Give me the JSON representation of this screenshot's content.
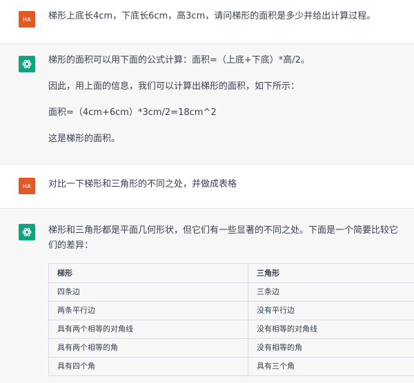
{
  "conversation": [
    {
      "role": "user",
      "avatar_label": "HA",
      "text": "梯形上底长4cm，下底长6cm，高3cm，请问梯形的面积是多少并给出计算过程。"
    },
    {
      "role": "assistant",
      "paragraphs": [
        "梯形的面积可以用下面的公式计算：面积=（上底+下底）*高/2。",
        "因此，用上面的信息，我们可以计算出梯形的面积，如下所示：",
        "面积=（4cm+6cm）*3cm/2=18cm^2",
        "这是梯形的面积。"
      ]
    },
    {
      "role": "user",
      "avatar_label": "HA",
      "text": "对比一下梯形和三角形的不同之处，并做成表格"
    },
    {
      "role": "assistant",
      "intro": "梯形和三角形都是平面几何形状，但它们有一些显著的不同之处。下面是一个简要比较它们的差异：",
      "table": {
        "headers": [
          "梯形",
          "三角形"
        ],
        "rows": [
          [
            "四条边",
            "三条边"
          ],
          [
            "两条平行边",
            "没有平行边"
          ],
          [
            "具有两个相等的对角线",
            "没有相等的对角线"
          ],
          [
            "具有两个相等的角",
            "没有相等的角"
          ],
          [
            "具有四个角",
            "具有三个角"
          ]
        ]
      }
    }
  ],
  "colors": {
    "user_avatar": "#e05a26",
    "assistant_avatar": "#10a37f",
    "assistant_bg": "#f7f7f8"
  }
}
